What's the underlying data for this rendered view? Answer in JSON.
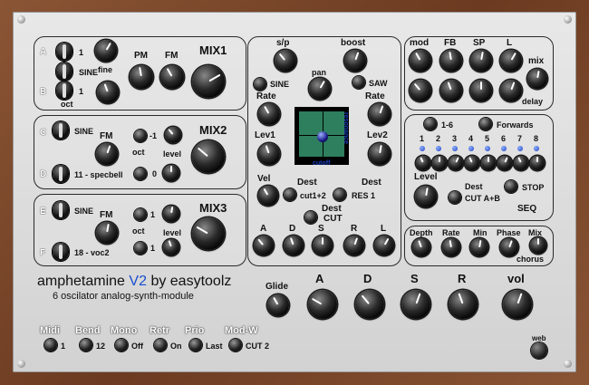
{
  "title": {
    "name": "amphetamine",
    "version": "V2",
    "by": "by easytoolz",
    "subtitle": "6 oscilator analog-synth-module"
  },
  "colors": {
    "panel": "#d8d8d8",
    "frame": "#7a4a2c",
    "version": "#1a4fd0",
    "xypad": "#2e7f5e",
    "leds": "#2a52d0"
  },
  "osc_ab": {
    "letter_a": "A",
    "letter_b": "B",
    "val_a": "1",
    "wave": "SINE",
    "val_b": "1",
    "fine": "fine",
    "oct": "oct",
    "pm": "PM",
    "fm": "FM",
    "mix": "MIX1"
  },
  "osc_cd": {
    "letter_c": "C",
    "letter_d": "D",
    "wave_c": "SINE",
    "wave_d": "11 - specbell",
    "fm": "FM",
    "oct": "oct",
    "level": "level",
    "val_oct": "-1",
    "val_level": "0",
    "mix": "MIX2"
  },
  "osc_ef": {
    "letter_e": "E",
    "letter_f": "F",
    "wave_e": "SINE",
    "wave_f": "18 - voc2",
    "fm": "FM",
    "oct": "oct",
    "level": "level",
    "val_oct": "1",
    "val_level": "1",
    "mix": "MIX3"
  },
  "lfo": {
    "sp": "s/p",
    "boost": "boost",
    "pan": "pan",
    "sine": "SINE",
    "saw": "SAW",
    "rate_l": "Rate",
    "rate_r": "Rate",
    "lev1": "Lev1",
    "lev2": "Lev2",
    "resonance": "resonance",
    "cutoff": "cutoff",
    "vel": "Vel",
    "dest": "Dest",
    "dest_r": "Dest",
    "cut12": "cut1+2",
    "res1": "RES 1",
    "dest_cut_label": "Dest",
    "dest_cut": "CUT",
    "env": [
      "A",
      "D",
      "S",
      "R",
      "L"
    ]
  },
  "fx_top": {
    "mod": "mod",
    "fb": "FB",
    "sp": "SP",
    "l": "L",
    "mix": "mix",
    "delay": "delay"
  },
  "seq": {
    "range": "1-6",
    "direction": "Forwards",
    "steps": [
      "1",
      "2",
      "3",
      "4",
      "5",
      "6",
      "7",
      "8"
    ],
    "level": "Level",
    "dest": "Dest",
    "dest_val": "CUT A+B",
    "stop": "STOP",
    "name": "SEQ"
  },
  "chorus": {
    "depth": "Depth",
    "rate": "Rate",
    "min": "Min",
    "phase": "Phase",
    "mix": "Mix",
    "name": "chorus"
  },
  "amp": {
    "glide": "Glide",
    "a": "A",
    "d": "D",
    "s": "S",
    "r": "R",
    "vol": "vol"
  },
  "bottom": [
    {
      "label": "Midi",
      "value": "1"
    },
    {
      "label": "Bend",
      "value": "12"
    },
    {
      "label": "Mono",
      "value": "Off"
    },
    {
      "label": "Retr",
      "value": "On"
    },
    {
      "label": "Prio",
      "value": "Last"
    },
    {
      "label": "Mod-W",
      "value": "CUT 2"
    }
  ],
  "web": "web"
}
